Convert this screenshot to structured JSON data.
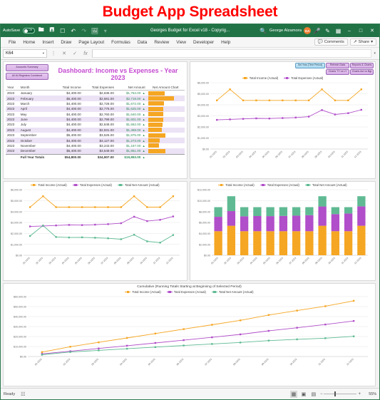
{
  "banner": {
    "title": "Budget App Spreadsheet",
    "color": "#ff0000"
  },
  "titlebar": {
    "autosave_label": "AutoSave",
    "autosave_state": "Off",
    "document_title": "Georges Budget for Excel v18 - Copyrig...",
    "user_name": "George Alzamora",
    "avatar_initials": "GA",
    "icons": [
      "save-icon",
      "export-icon",
      "touch-icon",
      "undo-icon",
      "redo-icon",
      "picture-icon",
      "customize-icon",
      "search-icon",
      "microphone-icon",
      "pen-icon",
      "present-icon"
    ],
    "window_buttons": [
      "minimize",
      "maximize",
      "close"
    ]
  },
  "ribbon": {
    "tabs": [
      "File",
      "Home",
      "Insert",
      "Draw",
      "Page Layout",
      "Formulas",
      "Data",
      "Review",
      "View",
      "Developer",
      "Help"
    ],
    "active_tab": "Home",
    "comments_label": "Comments",
    "share_label": "Share"
  },
  "formula_bar": {
    "name_box": "K64",
    "formula": "",
    "cancel_label": "✕",
    "enter_label": "✓",
    "function_label": "fx"
  },
  "dashboard": {
    "title": "Dashboard: Income vs Expenses - Year 2023",
    "left_buttons": [
      "Accounts Summary",
      "All 64 Registers Combined"
    ],
    "right_buttons": [
      "Set Year (Time Period)",
      "Refresh Data",
      "Reports & Charts",
      "Charts TY vs LY",
      "Charts Act vs Bgt"
    ],
    "table": {
      "headers": [
        "Year",
        "Month",
        "Total Income",
        "Total Expenses",
        "Net Amount",
        "Net Amount Chart"
      ],
      "rows": [
        {
          "year": "2023",
          "month": "January",
          "income": "$4,400.00",
          "expenses": "$2,636.00",
          "net": "$1,764.00",
          "bar": 47
        },
        {
          "year": "2023",
          "month": "February",
          "income": "$5,400.00",
          "expenses": "$2,681.00",
          "net": "$2,719.00",
          "bar": 73
        },
        {
          "year": "2023",
          "month": "March",
          "income": "$4,400.00",
          "expenses": "$2,728.00",
          "net": "$1,672.00",
          "bar": 45
        },
        {
          "year": "2023",
          "month": "April",
          "income": "$4,400.00",
          "expenses": "$2,775.00",
          "net": "$1,625.00",
          "bar": 44
        },
        {
          "year": "2023",
          "month": "May",
          "income": "$4,400.00",
          "expenses": "$2,760.00",
          "net": "$1,640.00",
          "bar": 44
        },
        {
          "year": "2023",
          "month": "June",
          "income": "$4,400.00",
          "expenses": "$2,799.00",
          "net": "$1,601.00",
          "bar": 43
        },
        {
          "year": "2023",
          "month": "July",
          "income": "$4,400.00",
          "expenses": "$2,848.00",
          "net": "$1,552.00",
          "bar": 42
        },
        {
          "year": "2023",
          "month": "August",
          "income": "$4,400.00",
          "expenses": "$2,931.00",
          "net": "$1,469.00",
          "bar": 39
        },
        {
          "year": "2023",
          "month": "September",
          "income": "$5,400.00",
          "expenses": "$3,525.00",
          "net": "$1,875.00",
          "bar": 50
        },
        {
          "year": "2023",
          "month": "October",
          "income": "$4,400.00",
          "expenses": "$3,127.00",
          "net": "$1,273.00",
          "bar": 34
        },
        {
          "year": "2023",
          "month": "November",
          "income": "$4,400.00",
          "expenses": "$3,243.00",
          "net": "$1,157.00",
          "bar": 31
        },
        {
          "year": "2023",
          "month": "December",
          "income": "$5,400.00",
          "expenses": "$3,549.00",
          "net": "$1,851.00",
          "bar": 50
        }
      ],
      "totals": {
        "label": "Full Year Totals",
        "income": "$54,800.00",
        "expenses": "$34,907.00",
        "net": "$19,893.00"
      }
    }
  },
  "colors": {
    "income": "#f5a623",
    "expenses": "#b14ec9",
    "net": "#5fba93",
    "excel_green": "#217346",
    "dash_title": "#c44ad0"
  },
  "chart_data": [
    {
      "id": "chart-income-vs-expenses",
      "type": "line",
      "title": "",
      "xlabel": "",
      "ylabel": "",
      "ylim": [
        0,
        6000
      ],
      "yticks": [
        "$0.00",
        "$1,000.00",
        "$2,000.00",
        "$3,000.00",
        "$4,000.00",
        "$5,000.00",
        "$6,000.00"
      ],
      "grid": true,
      "legend_position": "top",
      "categories": [
        "01-2023",
        "02-2023",
        "03-2023",
        "04-2023",
        "05-2023",
        "06-2023",
        "07-2023",
        "08-2023",
        "09-2023",
        "10-2023",
        "11-2023",
        "12-2023"
      ],
      "series": [
        {
          "name": "Total Income (Actual)",
          "color": "#f5a623",
          "values": [
            4400,
            5400,
            4400,
            4400,
            4400,
            4400,
            4400,
            4400,
            5400,
            4400,
            4400,
            5400
          ]
        },
        {
          "name": "Total Expenses (Actual)",
          "color": "#b14ec9",
          "values": [
            2636,
            2681,
            2728,
            2775,
            2760,
            2799,
            2848,
            2931,
            3525,
            3127,
            3243,
            3549
          ]
        }
      ]
    },
    {
      "id": "chart-income-expenses-net",
      "type": "line",
      "title": "",
      "xlabel": "",
      "ylabel": "",
      "ylim": [
        0,
        6000
      ],
      "yticks": [
        "$0.00",
        "$1,000.00",
        "$2,000.00",
        "$3,000.00",
        "$4,000.00",
        "$5,000.00",
        "$6,000.00"
      ],
      "grid": true,
      "legend_position": "top",
      "categories": [
        "01-2023",
        "02-2023",
        "03-2023",
        "04-2023",
        "05-2023",
        "06-2023",
        "07-2023",
        "08-2023",
        "09-2023",
        "10-2023",
        "11-2023",
        "12-2023"
      ],
      "series": [
        {
          "name": "Total Income (Actual)",
          "color": "#f5a623",
          "values": [
            4400,
            5400,
            4400,
            4400,
            4400,
            4400,
            4400,
            4400,
            5400,
            4400,
            4400,
            5400
          ]
        },
        {
          "name": "Total Expenses (Actual)",
          "color": "#b14ec9",
          "values": [
            2636,
            2681,
            2728,
            2775,
            2760,
            2799,
            2848,
            2931,
            3525,
            3127,
            3243,
            3549
          ]
        },
        {
          "name": "Total Net Amount (Actual)",
          "color": "#5fba93",
          "values": [
            1764,
            2719,
            1672,
            1625,
            1640,
            1601,
            1552,
            1469,
            1875,
            1273,
            1157,
            1851
          ]
        }
      ]
    },
    {
      "id": "chart-stacked-bars",
      "type": "bar",
      "stacked": true,
      "title": "",
      "xlabel": "",
      "ylabel": "",
      "ylim": [
        0,
        12000
      ],
      "yticks": [
        "$0.00",
        "$2,000.00",
        "$4,000.00",
        "$6,000.00",
        "$8,000.00",
        "$10,000.00",
        "$12,000.00"
      ],
      "grid": true,
      "legend_position": "top",
      "categories": [
        "01-2023",
        "02-2023",
        "03-2023",
        "04-2023",
        "05-2023",
        "06-2023",
        "07-2023",
        "08-2023",
        "09-2023",
        "10-2023",
        "11-2023",
        "12-2023"
      ],
      "series": [
        {
          "name": "Total Income (Actual)",
          "color": "#f5a623",
          "values": [
            4400,
            5400,
            4400,
            4400,
            4400,
            4400,
            4400,
            4400,
            5400,
            4400,
            4400,
            5400
          ]
        },
        {
          "name": "Total Expenses (Actual)",
          "color": "#b14ec9",
          "values": [
            2636,
            2681,
            2728,
            2775,
            2760,
            2799,
            2848,
            2931,
            3525,
            3127,
            3243,
            3549
          ]
        },
        {
          "name": "Total Net Amount (Actual)",
          "color": "#5fba93",
          "values": [
            1764,
            2719,
            1672,
            1625,
            1640,
            1601,
            1552,
            1469,
            1875,
            1273,
            1157,
            1851
          ]
        }
      ]
    },
    {
      "id": "chart-cumulative",
      "type": "line",
      "title": "Cumulative (Running Totals Starting at Beginning of Selected Period)",
      "xlabel": "",
      "ylabel": "",
      "ylim": [
        0,
        60000
      ],
      "yticks": [
        "$0.00",
        "$10,000.00",
        "$20,000.00",
        "$30,000.00",
        "$40,000.00",
        "$50,000.00",
        "$60,000.00"
      ],
      "grid": true,
      "legend_position": "top",
      "categories": [
        "01-2023",
        "02-2023",
        "03-2023",
        "04-2023",
        "05-2023",
        "06-2023",
        "07-2023",
        "08-2023",
        "09-2023",
        "10-2023",
        "11-2023",
        "12-2023"
      ],
      "series": [
        {
          "name": "Total Income (Actual)",
          "color": "#f5a623",
          "values": [
            4400,
            9800,
            14200,
            18600,
            23000,
            27400,
            31800,
            36200,
            41600,
            46000,
            50400,
            55800
          ]
        },
        {
          "name": "Total Expenses (Actual)",
          "color": "#b14ec9",
          "values": [
            2636,
            5317,
            8045,
            10820,
            13580,
            16379,
            19227,
            22158,
            25683,
            28810,
            32053,
            35602
          ]
        },
        {
          "name": "Total Net Amount (Actual)",
          "color": "#5fba93",
          "values": [
            1764,
            4483,
            6155,
            7780,
            9420,
            11021,
            12573,
            14042,
            15917,
            17190,
            18347,
            20198
          ]
        }
      ]
    }
  ],
  "status_bar": {
    "status": "Ready",
    "accessibility_icon": "accessibility-icon",
    "views": [
      "normal-view",
      "page-layout-view",
      "page-break-view"
    ],
    "active_view": "normal-view",
    "zoom_out": "−",
    "zoom_in": "+",
    "zoom_level": "55%"
  }
}
